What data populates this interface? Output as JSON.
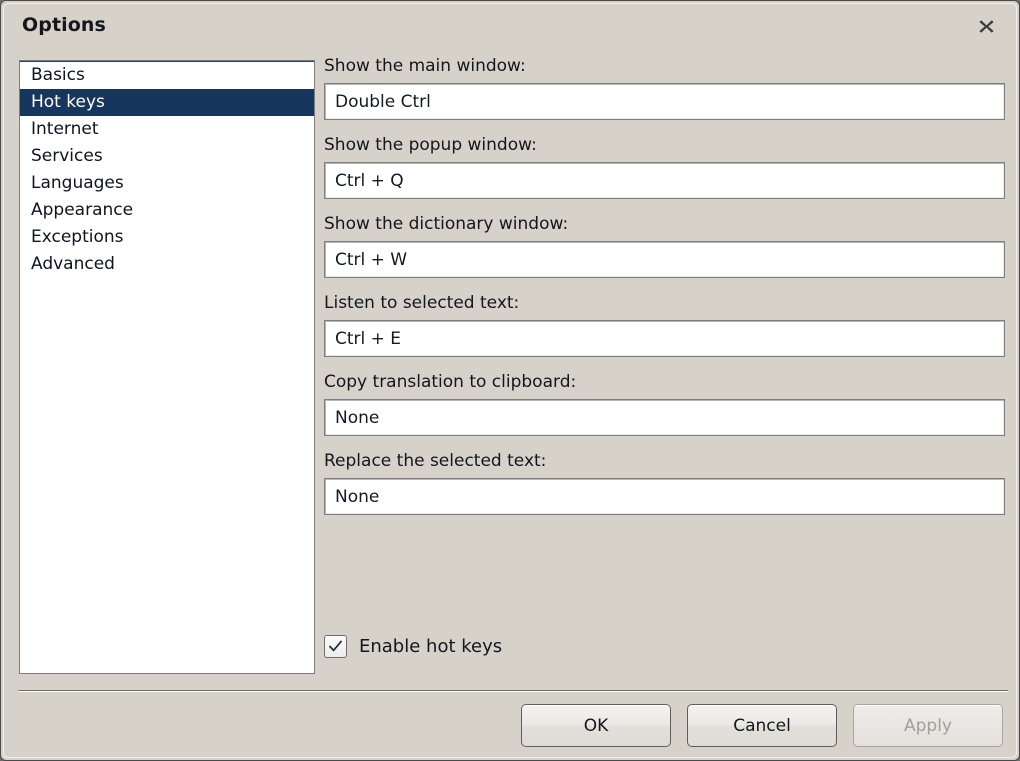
{
  "window": {
    "title": "Options",
    "close_icon": "close-x-icon"
  },
  "sidebar": {
    "items": [
      {
        "label": "Basics",
        "selected": false
      },
      {
        "label": "Hot keys",
        "selected": true
      },
      {
        "label": "Internet",
        "selected": false
      },
      {
        "label": "Services",
        "selected": false
      },
      {
        "label": "Languages",
        "selected": false
      },
      {
        "label": "Appearance",
        "selected": false
      },
      {
        "label": "Exceptions",
        "selected": false
      },
      {
        "label": "Advanced",
        "selected": false
      }
    ]
  },
  "settings": {
    "fields": [
      {
        "label": "Show the main window:",
        "value": "Double Ctrl"
      },
      {
        "label": "Show the popup window:",
        "value": "Ctrl + Q"
      },
      {
        "label": "Show the dictionary window:",
        "value": "Ctrl + W"
      },
      {
        "label": "Listen to selected text:",
        "value": "Ctrl + E"
      },
      {
        "label": "Copy translation to clipboard:",
        "value": "None"
      },
      {
        "label": "Replace the selected text:",
        "value": "None"
      }
    ],
    "enable_hotkeys": {
      "label": "Enable hot keys",
      "checked": true,
      "check_icon": "checkmark-icon"
    }
  },
  "footer": {
    "ok_label": "OK",
    "cancel_label": "Cancel",
    "apply_label": "Apply",
    "apply_enabled": false
  },
  "colors": {
    "dialog_background": "#d6d2ca",
    "selection": "#17365d",
    "field_background": "#ffffff",
    "text": "#13171d",
    "disabled_text": "#a3a09b"
  }
}
